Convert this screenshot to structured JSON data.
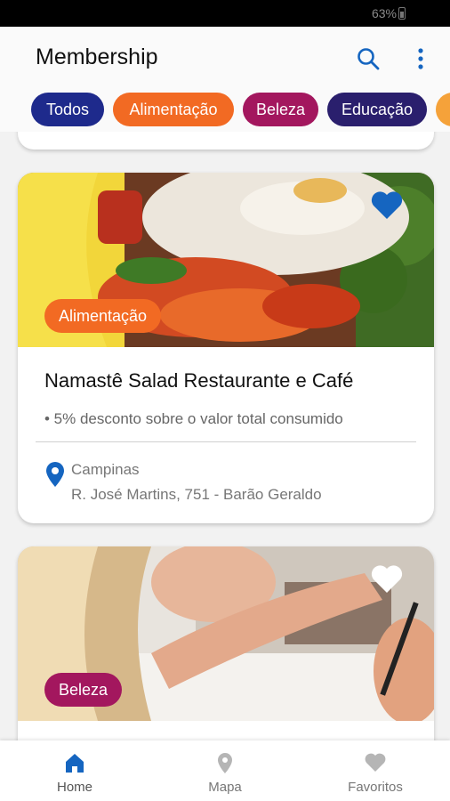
{
  "status_bar": {
    "battery": "63%"
  },
  "app_bar": {
    "title": "Membership"
  },
  "filters": [
    {
      "label": "Todos",
      "color": "#1e2a8c"
    },
    {
      "label": "Alimentação",
      "color": "#f26a23"
    },
    {
      "label": "Beleza",
      "color": "#a3175e"
    },
    {
      "label": "Educação",
      "color": "#2a1f6d"
    },
    {
      "label": "",
      "color": "#f5a23a"
    }
  ],
  "cards": [
    {
      "category": "Alimentação",
      "category_color": "#f26a23",
      "favorited": true,
      "title": "Namastê Salad Restaurante e Café",
      "benefit": "• 5% desconto sobre o valor total consumido",
      "city": "Campinas",
      "address": "R. José Martins, 751 - Barão Geraldo"
    },
    {
      "category": "Beleza",
      "category_color": "#a3175e",
      "favorited": false
    }
  ],
  "bottom_nav": [
    {
      "label": "Home",
      "icon": "home-icon",
      "active": true
    },
    {
      "label": "Mapa",
      "icon": "map-pin-icon",
      "active": false
    },
    {
      "label": "Favoritos",
      "icon": "heart-icon",
      "active": false
    }
  ],
  "colors": {
    "accent": "#1565c0",
    "inactive": "#b5b5b5"
  }
}
